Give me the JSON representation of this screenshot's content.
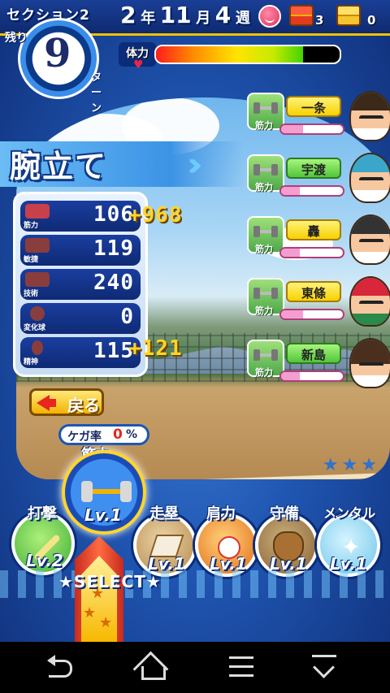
{
  "header": {
    "section_label": "セクション2",
    "date_year": "2",
    "date_year_unit": "年",
    "date_month": "11",
    "date_month_unit": "月",
    "date_week": "4",
    "date_week_unit": "週",
    "red_chest_count": "3",
    "gold_chest_count": "0"
  },
  "turns": {
    "remaining_label": "残り",
    "remaining_value": "9",
    "turn_label": "ターン"
  },
  "stamina": {
    "label": "体力",
    "level": 0.8
  },
  "title": "腕立て",
  "stats": [
    {
      "label": "筋力",
      "value": "106",
      "gain": "+968"
    },
    {
      "label": "敏捷",
      "value": "119",
      "gain": ""
    },
    {
      "label": "技術",
      "value": "240",
      "gain": ""
    },
    {
      "label": "変化球",
      "value": "0",
      "gain": ""
    },
    {
      "label": "精神",
      "value": "115",
      "gain": "+121"
    }
  ],
  "back_button": "戻る",
  "injury": {
    "label": "ケガ率",
    "value": "0",
    "unit": "%"
  },
  "partners": [
    {
      "type": "筋力",
      "name": "一条",
      "bond": 0.35,
      "plate": "yellow"
    },
    {
      "type": "筋力",
      "name": "宇渡",
      "bond": 0.3,
      "plate": "green"
    },
    {
      "type": "筋力",
      "name": "轟",
      "bond": 0.3,
      "plate": "yellow"
    },
    {
      "type": "筋力",
      "name": "東條",
      "bond": 0.35,
      "plate": "yellow"
    },
    {
      "type": "筋力",
      "name": "新島",
      "bond": 0.3,
      "plate": "green"
    }
  ],
  "training": {
    "selected": {
      "name": "筋力",
      "level": "Lv.1"
    },
    "options": [
      {
        "name": "打撃",
        "level": "Lv.2"
      },
      {
        "name": "走塁",
        "level": "Lv.1"
      },
      {
        "name": "肩力",
        "level": "Lv.1"
      },
      {
        "name": "守備",
        "level": "Lv.1"
      },
      {
        "name": "メンタル",
        "level": "Lv.1"
      }
    ],
    "select_label": "★SELECT★"
  },
  "colors": {
    "accent": "#f2c200",
    "panel_blue": "#1a3ea0",
    "gain_yellow": "#ffd52a",
    "bond_pink": "#f49ed0"
  }
}
